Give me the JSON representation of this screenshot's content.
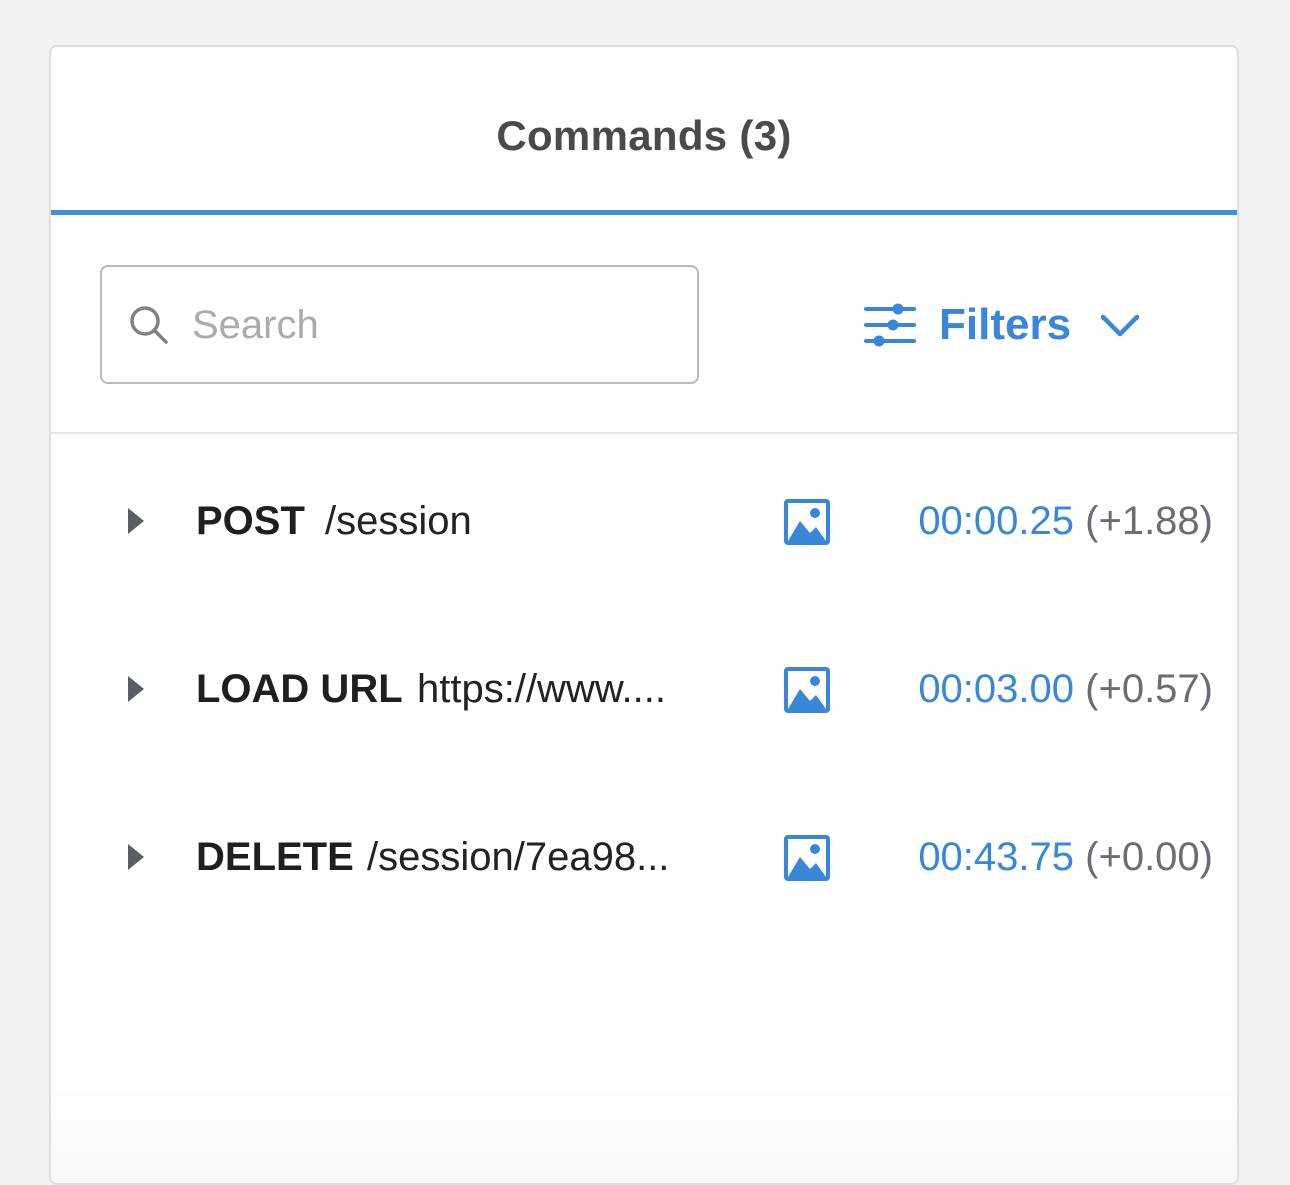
{
  "tab": {
    "title": "Commands (3)"
  },
  "search": {
    "placeholder": "Search",
    "value": ""
  },
  "filters": {
    "label": "Filters"
  },
  "commands": [
    {
      "method": "POST",
      "path": "/session",
      "time": "00:00.25",
      "delta": "(+1.88)"
    },
    {
      "method": "LOAD URL",
      "path": "https://www....",
      "time": "00:03.00",
      "delta": "(+0.57)"
    },
    {
      "method": "DELETE",
      "path": "/session/7ea98...",
      "time": "00:43.75",
      "delta": "(+0.00)"
    }
  ],
  "colors": {
    "accent": "#3a86d8",
    "tab_underline": "#3d8edb",
    "text_dark": "#1f1f1f",
    "text_muted": "#6a6d73",
    "border": "#dcdee3"
  },
  "icons": {
    "search": "search-icon",
    "filters": "sliders-icon",
    "chevron": "chevron-down-icon",
    "expand": "caret-right-icon",
    "screenshot": "image-icon"
  }
}
